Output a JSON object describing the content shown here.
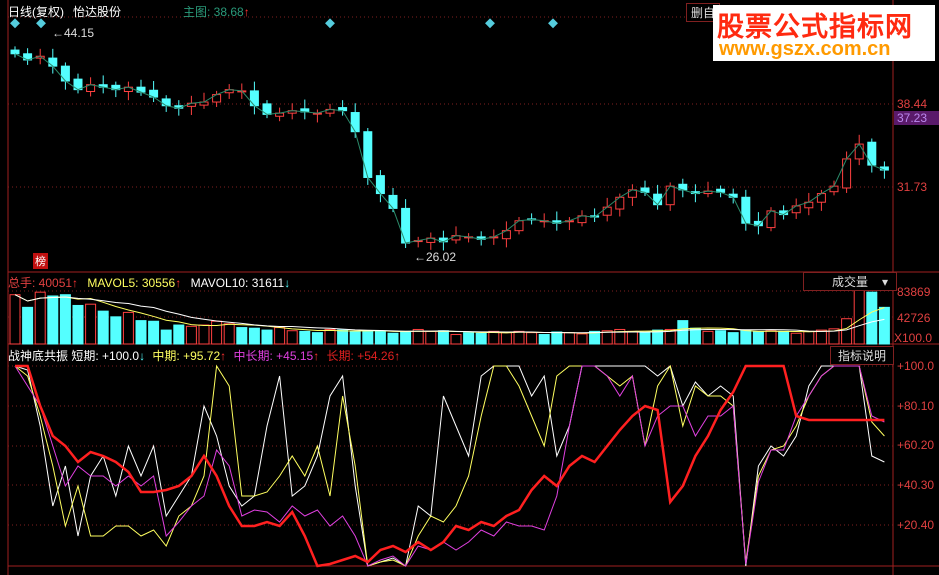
{
  "header": {
    "period": "日线(复权)",
    "stock": "怡达股份",
    "main_label": "主图: 38.68",
    "main_arrow": "↑",
    "delete_btn": "删自"
  },
  "watermark": {
    "title": "股票公式指标网",
    "url": "www.gszx.com.cn"
  },
  "price_panel": {
    "high_label": "44.15",
    "low_label": "26.02",
    "tag": "榜",
    "axis": [
      "38.44",
      "31.73"
    ],
    "current_price": "37.23",
    "closes": [
      42.5,
      42.0,
      42.3,
      41.5,
      40.3,
      39.6,
      40.0,
      39.8,
      39.6,
      39.8,
      39.4,
      39.0,
      38.3,
      38.1,
      38.5,
      38.6,
      39.2,
      39.6,
      39.5,
      38.3,
      37.6,
      37.7,
      37.9,
      37.8,
      37.7,
      38.0,
      37.9,
      36.2,
      32.5,
      31.2,
      30.0,
      27.2,
      27.4,
      27.6,
      27.3,
      27.8,
      27.7,
      27.5,
      27.7,
      28.2,
      29.0,
      29.1,
      29.0,
      28.8,
      29.0,
      29.4,
      29.3,
      30.1,
      30.9,
      31.5,
      31.3,
      30.3,
      31.8,
      31.5,
      31.2,
      31.4,
      31.3,
      30.9,
      28.8,
      28.6,
      29.8,
      29.5,
      30.2,
      30.5,
      31.2,
      31.8,
      34.0,
      35.2,
      33.5,
      33.1
    ],
    "colors": {
      "up": "#ff4040",
      "down": "#54ffff"
    }
  },
  "volume_panel": {
    "total_label": "总手: 40051",
    "total_arrow": "↑",
    "mavol5_label": "MAVOL5: 30556",
    "mavol5_arrow": "↑",
    "mavol10_label": "MAVOL10: 31611",
    "mavol10_arrow": "↓",
    "selector": "成交量",
    "axis": [
      "83869",
      "42726",
      "X100.0"
    ],
    "values": [
      78000,
      58000,
      82000,
      76000,
      78000,
      61000,
      63000,
      52000,
      43000,
      50000,
      37000,
      36000,
      22000,
      30000,
      28000,
      30000,
      36000,
      32000,
      26000,
      25000,
      22000,
      26000,
      21000,
      20000,
      18000,
      23000,
      22000,
      20000,
      21000,
      20000,
      17000,
      20000,
      23000,
      20000,
      21000,
      15000,
      18000,
      17000,
      20000,
      18000,
      20000,
      18000,
      15000,
      19000,
      18000,
      16000,
      20000,
      21000,
      23000,
      20000,
      18000,
      22000,
      23000,
      37000,
      25000,
      20000,
      21000,
      18000,
      22000,
      19000,
      21000,
      20000,
      17000,
      20000,
      22000,
      24000,
      40000,
      85000,
      82000,
      58000
    ]
  },
  "indicator_panel": {
    "name": "战神底共振",
    "short_label": "短期: +100.0",
    "short_arrow": "↓",
    "mid_label": "中期: +95.72",
    "mid_arrow": "↑",
    "midlong_label": "中长期: +45.15",
    "midlong_arrow": "↑",
    "long_label": "长期: +54.26",
    "long_arrow": "↑",
    "help_btn": "指标说明",
    "axis": [
      "+100.0",
      "+80.10",
      "+60.20",
      "+40.30",
      "+20.40"
    ],
    "short": [
      100,
      98,
      70,
      30,
      50,
      15,
      45,
      55,
      35,
      60,
      45,
      60,
      25,
      35,
      45,
      80,
      65,
      40,
      30,
      35,
      70,
      95,
      35,
      40,
      55,
      85,
      95,
      40,
      0,
      2,
      4,
      0,
      30,
      25,
      85,
      70,
      55,
      95,
      100,
      100,
      100,
      85,
      95,
      55,
      70,
      100,
      100,
      100,
      100,
      100,
      100,
      95,
      100,
      80,
      92,
      85,
      90,
      85,
      0,
      50,
      60,
      55,
      65,
      90,
      100,
      100,
      100,
      100,
      55,
      52
    ],
    "mid": [
      100,
      95,
      75,
      50,
      20,
      40,
      15,
      15,
      20,
      20,
      15,
      18,
      10,
      25,
      30,
      45,
      100,
      90,
      35,
      35,
      37,
      45,
      55,
      45,
      60,
      35,
      85,
      50,
      0,
      2,
      3,
      0,
      15,
      25,
      22,
      30,
      45,
      75,
      100,
      100,
      90,
      75,
      60,
      95,
      100,
      100,
      100,
      95,
      90,
      95,
      60,
      90,
      100,
      70,
      90,
      85,
      85,
      80,
      2,
      45,
      58,
      60,
      70,
      85,
      95,
      100,
      100,
      100,
      72,
      65
    ],
    "midlong": [
      100,
      90,
      80,
      60,
      40,
      50,
      45,
      45,
      40,
      45,
      40,
      45,
      15,
      22,
      30,
      35,
      58,
      50,
      25,
      28,
      27,
      22,
      30,
      25,
      28,
      20,
      25,
      15,
      0,
      3,
      5,
      0,
      10,
      8,
      12,
      8,
      12,
      18,
      15,
      22,
      20,
      20,
      18,
      35,
      70,
      100,
      100,
      95,
      85,
      95,
      60,
      75,
      80,
      80,
      65,
      75,
      75,
      80,
      1,
      42,
      58,
      58,
      75,
      85,
      95,
      100,
      100,
      100,
      75,
      72
    ],
    "long": [
      100,
      100,
      80,
      65,
      60,
      52,
      57,
      55,
      52,
      47,
      37,
      37,
      38,
      40,
      45,
      55,
      45,
      30,
      20,
      20,
      22,
      20,
      27,
      15,
      0,
      1,
      3,
      5,
      2,
      8,
      10,
      7,
      12,
      8,
      12,
      20,
      18,
      22,
      20,
      25,
      28,
      38,
      45,
      40,
      50,
      55,
      52,
      60,
      68,
      75,
      80,
      78,
      32,
      40,
      55,
      65,
      78,
      87,
      100,
      100,
      100,
      100,
      75,
      73,
      73,
      73,
      73,
      73,
      73,
      73
    ],
    "colors": {
      "short": "#ffffff",
      "mid": "#ffff60",
      "midlong": "#e040e0",
      "long": "#ff2020"
    }
  }
}
